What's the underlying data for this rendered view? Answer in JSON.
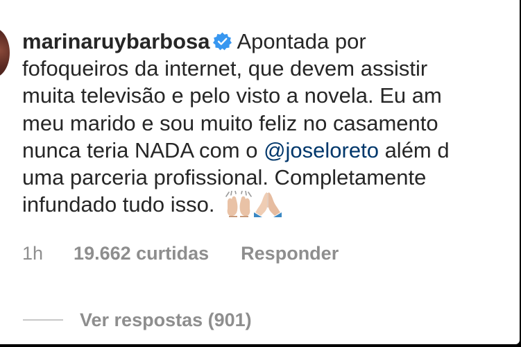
{
  "comment": {
    "username": "marinaruybarbosa",
    "verified_icon": "verified-badge-icon",
    "lines": [
      "Apontada por",
      "fofoqueiros da internet, que devem assistir",
      "muita televisão e pelo visto a novela. Eu am",
      "meu marido e sou muito feliz no casamento",
      "nunca teria NADA com o ",
      "uma parceria profissional. Completamente",
      "infundado tudo isso."
    ],
    "mention": "@joseloreto",
    "after_mention": " além d",
    "emojis": [
      "raising-hands-emoji",
      "folded-hands-emoji"
    ]
  },
  "meta": {
    "time": "1h",
    "likes": "19.662 curtidas",
    "reply": "Responder"
  },
  "replies": {
    "label": "Ver respostas (901)"
  },
  "colors": {
    "text": "#262626",
    "secondary": "#8e8e8e",
    "mention": "#00376b",
    "verified": "#3897f0"
  }
}
